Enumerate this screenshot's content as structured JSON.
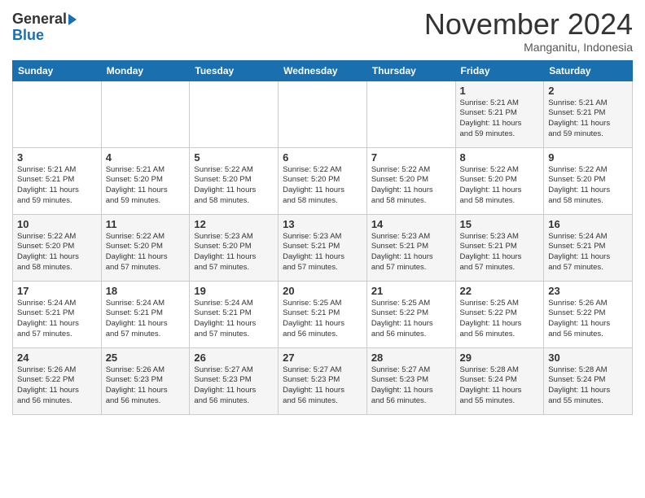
{
  "header": {
    "logo_line1": "General",
    "logo_line2": "Blue",
    "month": "November 2024",
    "location": "Manganitu, Indonesia"
  },
  "weekdays": [
    "Sunday",
    "Monday",
    "Tuesday",
    "Wednesday",
    "Thursday",
    "Friday",
    "Saturday"
  ],
  "weeks": [
    [
      {
        "day": "",
        "info": ""
      },
      {
        "day": "",
        "info": ""
      },
      {
        "day": "",
        "info": ""
      },
      {
        "day": "",
        "info": ""
      },
      {
        "day": "",
        "info": ""
      },
      {
        "day": "1",
        "info": "Sunrise: 5:21 AM\nSunset: 5:21 PM\nDaylight: 11 hours\nand 59 minutes."
      },
      {
        "day": "2",
        "info": "Sunrise: 5:21 AM\nSunset: 5:21 PM\nDaylight: 11 hours\nand 59 minutes."
      }
    ],
    [
      {
        "day": "3",
        "info": "Sunrise: 5:21 AM\nSunset: 5:21 PM\nDaylight: 11 hours\nand 59 minutes."
      },
      {
        "day": "4",
        "info": "Sunrise: 5:21 AM\nSunset: 5:20 PM\nDaylight: 11 hours\nand 59 minutes."
      },
      {
        "day": "5",
        "info": "Sunrise: 5:22 AM\nSunset: 5:20 PM\nDaylight: 11 hours\nand 58 minutes."
      },
      {
        "day": "6",
        "info": "Sunrise: 5:22 AM\nSunset: 5:20 PM\nDaylight: 11 hours\nand 58 minutes."
      },
      {
        "day": "7",
        "info": "Sunrise: 5:22 AM\nSunset: 5:20 PM\nDaylight: 11 hours\nand 58 minutes."
      },
      {
        "day": "8",
        "info": "Sunrise: 5:22 AM\nSunset: 5:20 PM\nDaylight: 11 hours\nand 58 minutes."
      },
      {
        "day": "9",
        "info": "Sunrise: 5:22 AM\nSunset: 5:20 PM\nDaylight: 11 hours\nand 58 minutes."
      }
    ],
    [
      {
        "day": "10",
        "info": "Sunrise: 5:22 AM\nSunset: 5:20 PM\nDaylight: 11 hours\nand 58 minutes."
      },
      {
        "day": "11",
        "info": "Sunrise: 5:22 AM\nSunset: 5:20 PM\nDaylight: 11 hours\nand 57 minutes."
      },
      {
        "day": "12",
        "info": "Sunrise: 5:23 AM\nSunset: 5:20 PM\nDaylight: 11 hours\nand 57 minutes."
      },
      {
        "day": "13",
        "info": "Sunrise: 5:23 AM\nSunset: 5:21 PM\nDaylight: 11 hours\nand 57 minutes."
      },
      {
        "day": "14",
        "info": "Sunrise: 5:23 AM\nSunset: 5:21 PM\nDaylight: 11 hours\nand 57 minutes."
      },
      {
        "day": "15",
        "info": "Sunrise: 5:23 AM\nSunset: 5:21 PM\nDaylight: 11 hours\nand 57 minutes."
      },
      {
        "day": "16",
        "info": "Sunrise: 5:24 AM\nSunset: 5:21 PM\nDaylight: 11 hours\nand 57 minutes."
      }
    ],
    [
      {
        "day": "17",
        "info": "Sunrise: 5:24 AM\nSunset: 5:21 PM\nDaylight: 11 hours\nand 57 minutes."
      },
      {
        "day": "18",
        "info": "Sunrise: 5:24 AM\nSunset: 5:21 PM\nDaylight: 11 hours\nand 57 minutes."
      },
      {
        "day": "19",
        "info": "Sunrise: 5:24 AM\nSunset: 5:21 PM\nDaylight: 11 hours\nand 57 minutes."
      },
      {
        "day": "20",
        "info": "Sunrise: 5:25 AM\nSunset: 5:21 PM\nDaylight: 11 hours\nand 56 minutes."
      },
      {
        "day": "21",
        "info": "Sunrise: 5:25 AM\nSunset: 5:22 PM\nDaylight: 11 hours\nand 56 minutes."
      },
      {
        "day": "22",
        "info": "Sunrise: 5:25 AM\nSunset: 5:22 PM\nDaylight: 11 hours\nand 56 minutes."
      },
      {
        "day": "23",
        "info": "Sunrise: 5:26 AM\nSunset: 5:22 PM\nDaylight: 11 hours\nand 56 minutes."
      }
    ],
    [
      {
        "day": "24",
        "info": "Sunrise: 5:26 AM\nSunset: 5:22 PM\nDaylight: 11 hours\nand 56 minutes."
      },
      {
        "day": "25",
        "info": "Sunrise: 5:26 AM\nSunset: 5:23 PM\nDaylight: 11 hours\nand 56 minutes."
      },
      {
        "day": "26",
        "info": "Sunrise: 5:27 AM\nSunset: 5:23 PM\nDaylight: 11 hours\nand 56 minutes."
      },
      {
        "day": "27",
        "info": "Sunrise: 5:27 AM\nSunset: 5:23 PM\nDaylight: 11 hours\nand 56 minutes."
      },
      {
        "day": "28",
        "info": "Sunrise: 5:27 AM\nSunset: 5:23 PM\nDaylight: 11 hours\nand 56 minutes."
      },
      {
        "day": "29",
        "info": "Sunrise: 5:28 AM\nSunset: 5:24 PM\nDaylight: 11 hours\nand 55 minutes."
      },
      {
        "day": "30",
        "info": "Sunrise: 5:28 AM\nSunset: 5:24 PM\nDaylight: 11 hours\nand 55 minutes."
      }
    ]
  ]
}
